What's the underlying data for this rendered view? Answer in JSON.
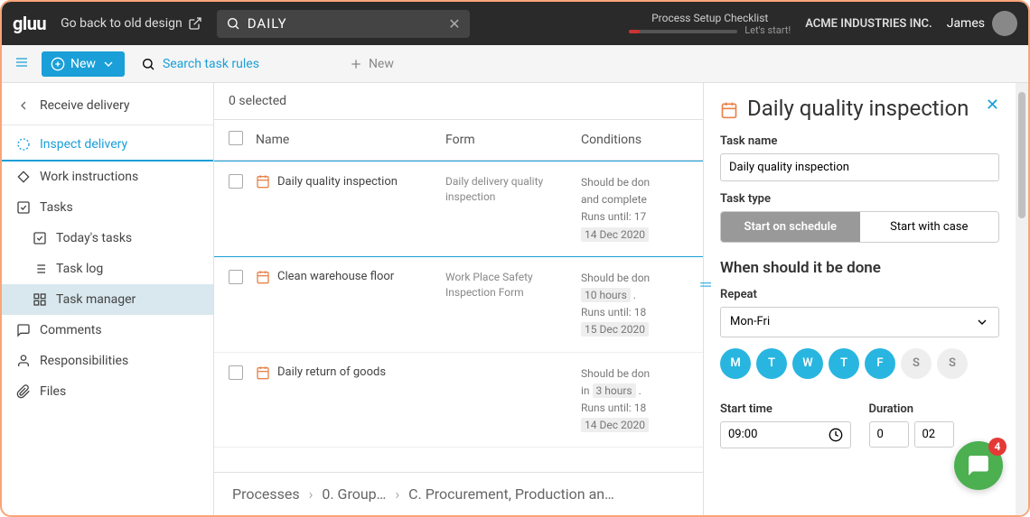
{
  "topbar": {
    "logo": "gluu",
    "old_design": "Go back to old design",
    "search_value": "DAILY",
    "checklist_title": "Process Setup Checklist",
    "checklist_cta": "Let's start!",
    "company": "ACME INDUSTRIES INC.",
    "user": "James"
  },
  "toolbar": {
    "new_label": "New",
    "search_placeholder": "Search task rules",
    "plus_new": "New"
  },
  "sidebar": {
    "back": "Receive delivery",
    "active": "Inspect delivery",
    "items": [
      "Work instructions",
      "Tasks",
      "Today's tasks",
      "Task log",
      "Task manager",
      "Comments",
      "Responsibilities",
      "Files"
    ]
  },
  "table": {
    "selected_text": "0 selected",
    "headers": {
      "name": "Name",
      "form": "Form",
      "conditions": "Conditions"
    },
    "rows": [
      {
        "name": "Daily quality inspection",
        "form": "Daily delivery quality inspection",
        "cond_l1": "Should be don",
        "cond_l2": "and complete",
        "runs": "Runs until:  17",
        "date": "14 Dec 2020"
      },
      {
        "name": "Clean warehouse floor",
        "form": "Work Place Safety Inspection Form",
        "cond_l1": "Should be don",
        "cond_tag1": "10 hours",
        "runs": "Runs until:  18",
        "date": "15 Dec 2020"
      },
      {
        "name": "Daily return of goods",
        "form": "",
        "cond_l1": "Should be don",
        "cond_pre": "in ",
        "cond_tag1": "3 hours",
        "runs": "Runs until:  18",
        "date": "14 Dec 2020"
      }
    ]
  },
  "breadcrumb": {
    "a": "Processes",
    "b": "0. Group…",
    "c": "C. Procurement, Production an…"
  },
  "panel": {
    "title": "Daily quality inspection",
    "task_name_label": "Task name",
    "task_name_value": "Daily quality inspection",
    "task_type_label": "Task type",
    "type_schedule": "Start on schedule",
    "type_case": "Start with case",
    "when_title": "When should it be done",
    "repeat_label": "Repeat",
    "repeat_value": "Mon-Fri",
    "days": [
      {
        "l": "M",
        "on": true
      },
      {
        "l": "T",
        "on": true
      },
      {
        "l": "W",
        "on": true
      },
      {
        "l": "T",
        "on": true
      },
      {
        "l": "F",
        "on": true
      },
      {
        "l": "S",
        "on": false
      },
      {
        "l": "S",
        "on": false
      }
    ],
    "start_time_label": "Start time",
    "start_time_value": "09:00",
    "duration_label": "Duration",
    "duration_h": "0",
    "duration_m": "02"
  },
  "chat": {
    "badge": "4"
  }
}
